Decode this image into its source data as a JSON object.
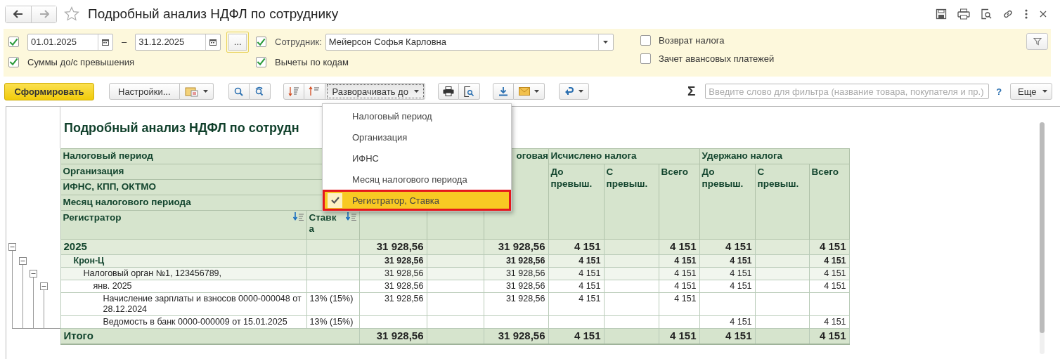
{
  "window": {
    "title": "Подробный анализ НДФЛ по сотруднику",
    "favorite": false
  },
  "filters": {
    "period": {
      "checked": true,
      "from": "01.01.2025",
      "separator": "–",
      "to": "31.12.2025",
      "more_button": "...",
      "option": {
        "label": "Суммы до/с превышения",
        "checked": true
      }
    },
    "employee": {
      "checked": true,
      "label": "Сотрудник:",
      "value": "Мейерсон Софья Карловна",
      "option": {
        "label": "Вычеты по кодам",
        "checked": true
      }
    },
    "extra_options": [
      {
        "label": "Возврат налога",
        "checked": false
      },
      {
        "label": "Зачет авансовых платежей",
        "checked": false
      }
    ]
  },
  "toolbar": {
    "generate": "Сформировать",
    "settings": "Настройки...",
    "expand_to": {
      "label": "Разворачивать до",
      "open": true
    },
    "sum_symbol": "Σ",
    "filter_placeholder": "Введите слово для фильтра (название товара, покупателя и пр.)",
    "help": "?",
    "more": "Еще"
  },
  "expand_menu": [
    {
      "label": "Налоговый период",
      "checked": false,
      "selected": false
    },
    {
      "label": "Организация",
      "checked": false,
      "selected": false
    },
    {
      "label": "ИФНС",
      "checked": false,
      "selected": false
    },
    {
      "label": "Месяц налогового периода",
      "checked": false,
      "selected": false
    },
    {
      "label": "Регистратор, Ставка",
      "checked": true,
      "selected": true
    }
  ],
  "report": {
    "title": "Подробный анализ НДФЛ по сотрудн",
    "grouping_headers": [
      "Налоговый период",
      "Организация",
      "ИФНС, КПП, ОКТМО",
      "Месяц налогового периода"
    ],
    "detail_columns": [
      "Регистратор",
      "Ставка"
    ],
    "column_5": "оговая",
    "groups": [
      {
        "title": "Исчислено налога",
        "columns": [
          "До превыш.",
          "С превыш.",
          "Всего"
        ]
      },
      {
        "title": "Удержано налога",
        "columns": [
          "До превыш.",
          "С превыш.",
          "Всего"
        ]
      }
    ],
    "rows": [
      {
        "label": "2025",
        "expanded": true,
        "values": {
          "column_3": "31 928,56",
          "column_5": "31 928,56",
          "calculated_before": "4 151",
          "calculated_total": "4 151",
          "withheld_before": "4 151",
          "withheld_total": "4 151"
        },
        "children": [
          {
            "label": "Крон-Ц",
            "expanded": true,
            "values": {
              "column_3": "31 928,56",
              "column_5": "31 928,56",
              "calculated_before": "4 151",
              "calculated_total": "4 151",
              "withheld_before": "4 151",
              "withheld_total": "4 151"
            },
            "children": [
              {
                "label": "Налоговый орган №1, 123456789,",
                "expanded": true,
                "values": {
                  "column_3": "31 928,56",
                  "column_5": "31 928,56",
                  "calculated_before": "4 151",
                  "calculated_total": "4 151",
                  "withheld_before": "4 151",
                  "withheld_total": "4 151"
                },
                "children": [
                  {
                    "label": "янв. 2025",
                    "expanded": true,
                    "values": {
                      "column_3": "31 928,56",
                      "column_5": "31 928,56",
                      "calculated_before": "4 151",
                      "calculated_total": "4 151",
                      "withheld_before": "4 151",
                      "withheld_total": "4 151"
                    },
                    "children": [
                      {
                        "label": "Начисление зарплаты и взносов 0000-000048 от 28.12.2024",
                        "rate": "13% (15%)",
                        "values": {
                          "column_3": "31 928,56",
                          "column_5": "31 928,56",
                          "calculated_before": "4 151",
                          "calculated_total": "4 151"
                        }
                      },
                      {
                        "label": "Ведомость в банк 0000-000009 от 15.01.2025",
                        "rate": "13% (15%)",
                        "values": {
                          "withheld_before": "4 151",
                          "withheld_total": "4 151"
                        }
                      }
                    ]
                  }
                ]
              }
            ]
          }
        ]
      }
    ],
    "total": {
      "label": "Итого",
      "values": {
        "column_3": "31 928,56",
        "column_5": "31 928,56",
        "calculated_before": "4 151",
        "calculated_total": "4 151",
        "withheld_before": "4 151",
        "withheld_total": "4 151"
      }
    }
  }
}
